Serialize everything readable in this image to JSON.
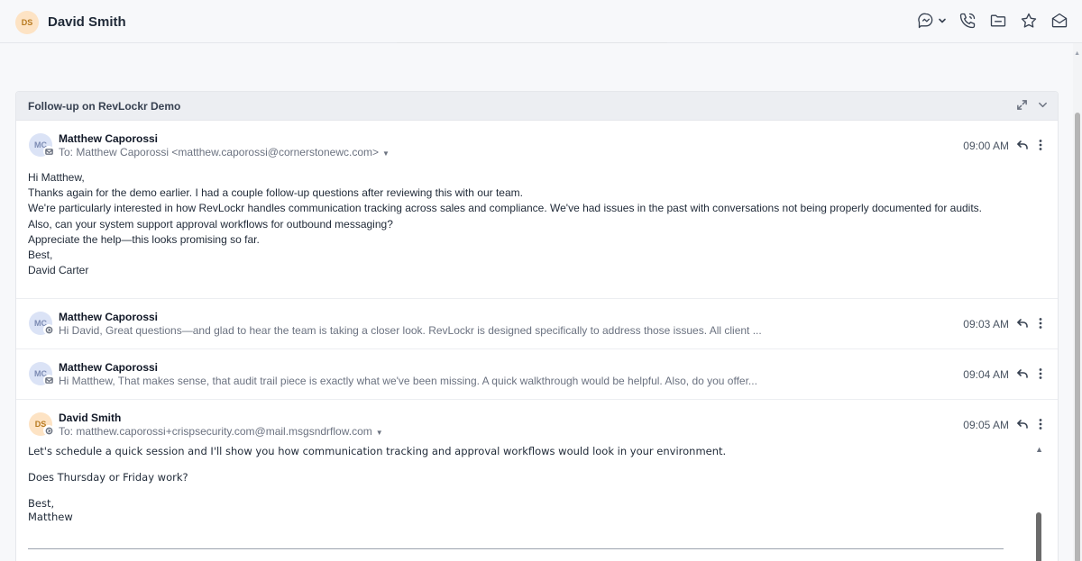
{
  "header": {
    "avatar_initials": "DS",
    "contact_name": "David Smith",
    "icons": [
      "chat-icon",
      "chevron-down-icon",
      "phone-icon",
      "folder-icon",
      "star-icon",
      "mail-icon"
    ]
  },
  "thread": {
    "subject": "Follow-up on RevLockr Demo",
    "messages": [
      {
        "initials": "MC",
        "sender": "Matthew Caporossi",
        "to": "To: Matthew Caporossi <matthew.caporossi@cornerstonewc.com>",
        "time": "09:00 AM",
        "body": [
          "Hi Matthew,",
          "Thanks again for the demo earlier. I had a couple follow-up questions after reviewing this with our team.",
          "We're particularly interested in how RevLockr handles communication tracking across sales and compliance. We've had issues in the past with conversations not being properly documented for audits.",
          "Also, can your system support approval workflows for outbound messaging?",
          "Appreciate the help—this looks promising so far.",
          "Best,",
          "David Carter"
        ]
      },
      {
        "initials": "MC",
        "sender": "Matthew Caporossi",
        "preview": "Hi David, Great questions—and glad to hear the team is taking a closer look. RevLockr is designed specifically to address those issues. All client ...",
        "time": "09:03 AM"
      },
      {
        "initials": "MC",
        "sender": "Matthew Caporossi",
        "preview": "Hi Matthew, That makes sense, that audit trail piece is exactly what we've been missing. A quick walkthrough would be helpful. Also, do you offer...",
        "time": "09:04 AM"
      },
      {
        "initials": "DS",
        "sender": "David Smith",
        "to": "To: matthew.caporossi+crispsecurity.com@mail.msgsndrflow.com",
        "time": "09:05 AM",
        "body": [
          "Let's schedule a quick session and I'll show you how communication tracking and approval workflows would look in your environment.",
          "Does Thursday or Friday work?",
          "Best,\nMatthew"
        ]
      }
    ]
  },
  "colors": {
    "background": "#f7f8fa",
    "panel_header": "#eceef2",
    "avatar_mc": "#dbe3f6",
    "avatar_ds": "#fde3c4"
  }
}
